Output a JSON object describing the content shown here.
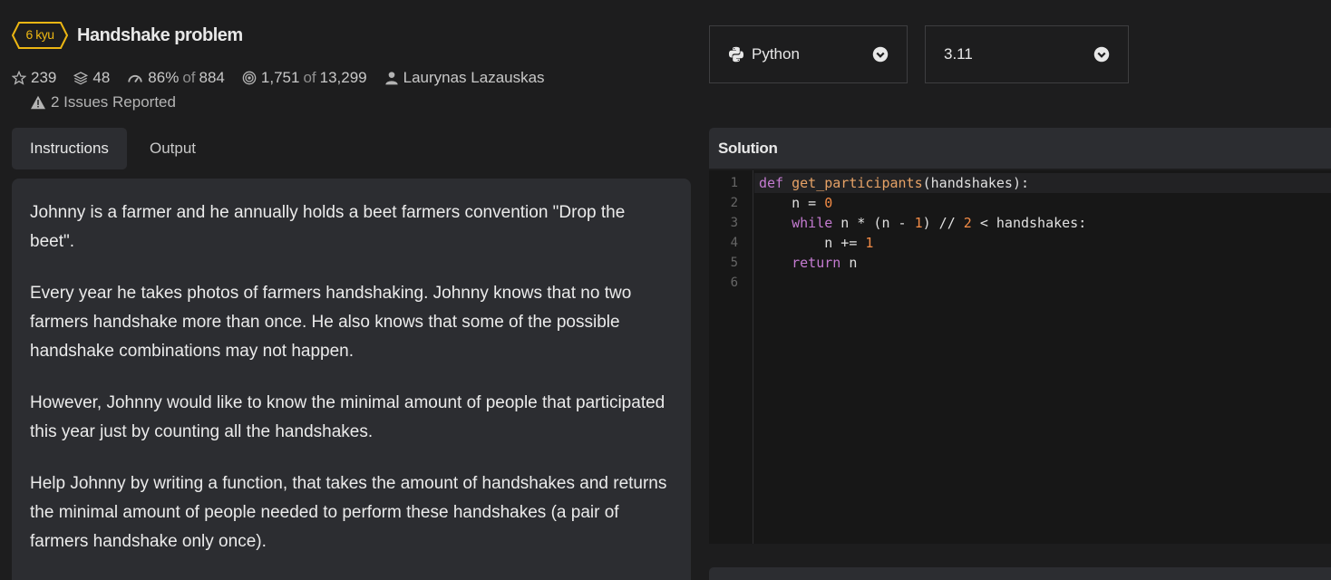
{
  "kata": {
    "rank": "6 kyu",
    "title": "Handshake problem",
    "stats": {
      "stars": "239",
      "collections": "48",
      "satisfaction_pct": "86%",
      "satisfaction_of": "of",
      "satisfaction_votes": "884",
      "completed": "1,751",
      "completed_of": "of",
      "attempted": "13,299",
      "author": "Laurynas Lazauskas"
    },
    "issues": "2 Issues Reported"
  },
  "tabs": [
    {
      "label": "Instructions",
      "active": true
    },
    {
      "label": "Output",
      "active": false
    }
  ],
  "instructions": {
    "paragraphs": [
      "Johnny is a farmer and he annually holds a beet farmers convention \"Drop the beet\".",
      "Every year he takes photos of farmers handshaking. Johnny knows that no two farmers handshake more than once. He also knows that some of the possible handshake combinations may not happen.",
      "However, Johnny would like to know the minimal amount of people that participated this year just by counting all the handshakes.",
      "Help Johnny by writing a function, that takes the amount of handshakes and returns the minimal amount of people needed to perform these handshakes (a pair of farmers handshake only once)."
    ]
  },
  "language_select": {
    "value": "Python",
    "icon": "python-icon"
  },
  "version_select": {
    "value": "3.11"
  },
  "solution": {
    "header": "Solution",
    "line_numbers": [
      "1",
      "2",
      "3",
      "4",
      "5",
      "6"
    ],
    "code": {
      "l1_kw": "def",
      "l1_fn": "get_participants",
      "l1_rest": "(handshakes):",
      "l2_a": "    n = ",
      "l2_num": "0",
      "l3_indent": "    ",
      "l3_kw": "while",
      "l3_a": " n * (n - ",
      "l3_num1": "1",
      "l3_b": ") // ",
      "l3_num2": "2",
      "l3_c": " < handshakes:",
      "l4_a": "        n += ",
      "l4_num": "1",
      "l5_indent": "    ",
      "l5_kw": "return",
      "l5_rest": " n",
      "l6": ""
    }
  },
  "colors": {
    "background": "#1d1d1e",
    "panel": "#2c2d31",
    "rank_yellow": "#ecb613",
    "keyword": "#c47bd1",
    "function": "#e6a266",
    "number": "#f28b46"
  }
}
